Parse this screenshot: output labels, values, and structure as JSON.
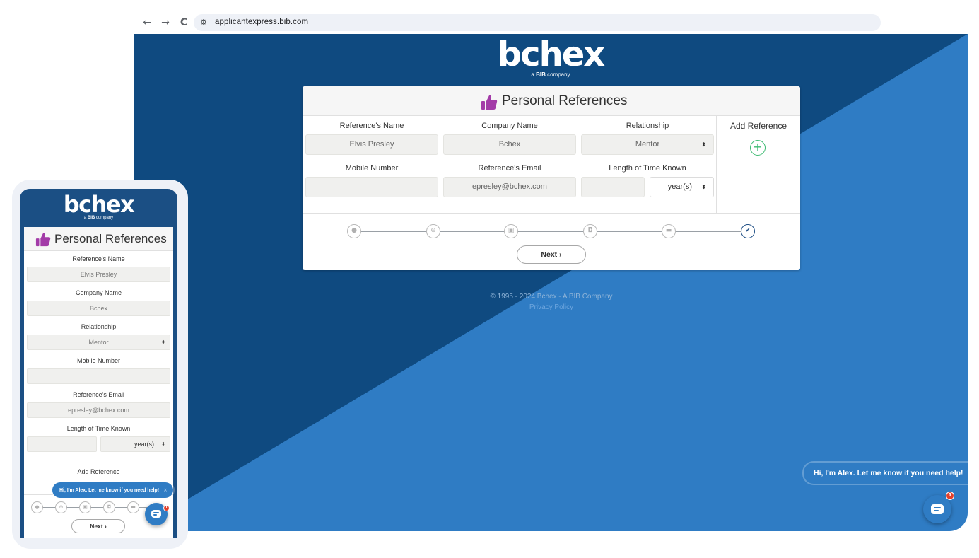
{
  "browser": {
    "back_icon": "arrow-left-icon",
    "back_glyph": "←",
    "forward_icon": "arrow-right-icon",
    "forward_glyph": "→",
    "reload_icon": "reload-icon",
    "reload_glyph": "C",
    "site_settings_icon": "tune-icon",
    "site_settings_glyph": "⚙",
    "url": "applicantexpress.bib.com"
  },
  "brand": {
    "logo_text": "bchex",
    "tagline_prefix": "a ",
    "tagline_bold": "BIB",
    "tagline_suffix": " company",
    "accent_color": "#a33ba8",
    "primary_dark": "#0f4a80",
    "primary_light": "#2f7cc4",
    "success_color": "#3dbb72"
  },
  "form": {
    "title": "Personal References",
    "fields": {
      "name_label": "Reference's Name",
      "name_value": "Elvis Presley",
      "company_label": "Company Name",
      "company_value": "Bchex",
      "relationship_label": "Relationship",
      "relationship_value": "Mentor",
      "mobile_label": "Mobile Number",
      "mobile_value": "",
      "email_label": "Reference's Email",
      "email_value": "epresley@bchex.com",
      "length_label": "Length of Time Known",
      "length_value": "",
      "length_unit": "year(s)"
    },
    "add_reference_label": "Add Reference",
    "add_icon": "plus-circle-icon",
    "add_glyph": "+",
    "caret_glyph": "⬍",
    "steps": [
      {
        "icon": "user-icon",
        "glyph": "●",
        "active": false
      },
      {
        "icon": "car-icon",
        "glyph": "⊖",
        "active": false
      },
      {
        "icon": "id-card-icon",
        "glyph": "▣",
        "active": false
      },
      {
        "icon": "briefcase-icon",
        "glyph": "◘",
        "active": false
      },
      {
        "icon": "graduation-cap-icon",
        "glyph": "▬",
        "active": false
      },
      {
        "icon": "thumbs-up-icon",
        "glyph": "✔",
        "active": true
      }
    ],
    "next_label": "Next ›"
  },
  "footer": {
    "copyright": "© 1995 - 2024 Bchex - A BIB Company",
    "privacy": "Privacy Policy"
  },
  "chat": {
    "greeting": "Hi, I'm Alex. Let me know if you need help!",
    "close_glyph": "×",
    "badge_count": "1",
    "launcher_icon": "chat-icon"
  }
}
